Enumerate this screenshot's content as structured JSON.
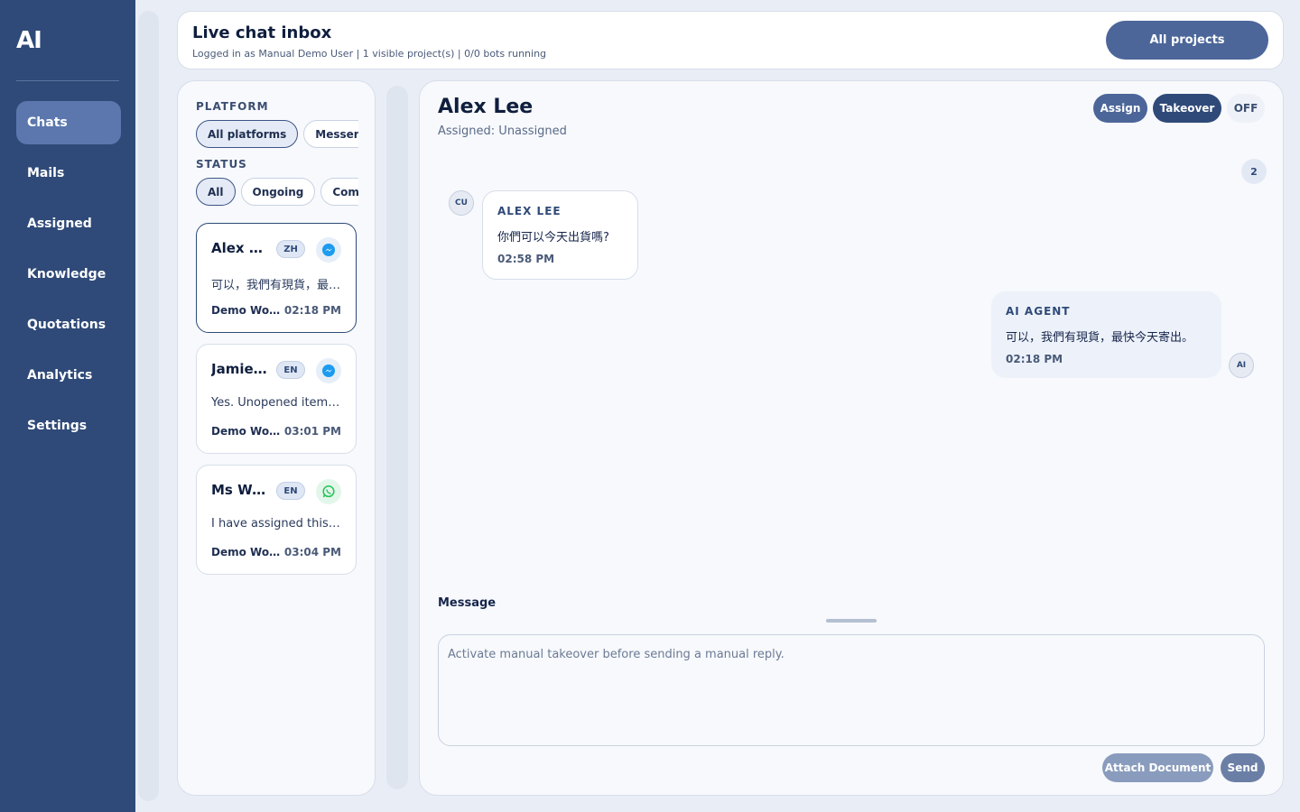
{
  "app": {
    "logo": "AI"
  },
  "sidebar": {
    "items": [
      {
        "label": "Chats",
        "active": true
      },
      {
        "label": "Mails"
      },
      {
        "label": "Assigned"
      },
      {
        "label": "Knowledge"
      },
      {
        "label": "Quotations"
      },
      {
        "label": "Analytics"
      },
      {
        "label": "Settings"
      }
    ]
  },
  "header": {
    "title": "Live chat inbox",
    "subtitle": "Logged in as Manual Demo User | 1 visible project(s) | 0/0 bots running",
    "projects_button": "All projects"
  },
  "filters": {
    "platform_label": "PLATFORM",
    "platform_chips": [
      "All platforms",
      "Messenger"
    ],
    "status_label": "STATUS",
    "status_chips": [
      "All",
      "Ongoing",
      "Completed"
    ]
  },
  "conversations": [
    {
      "name": "Alex Lee",
      "lang": "ZH",
      "platform": "messenger-icon",
      "preview": "可以，我們有現貨，最快今天寄出。",
      "workspace": "Demo Workspace",
      "time": "02:18 PM",
      "selected": true
    },
    {
      "name": "Jamie Chan",
      "lang": "EN",
      "platform": "messenger-icon",
      "preview": "Yes. Unopened items can be returned.",
      "workspace": "Demo Workspace",
      "time": "03:01 PM"
    },
    {
      "name": "Ms Wong",
      "lang": "EN",
      "platform": "whatsapp-icon",
      "preview": "I have assigned this request to our team.",
      "workspace": "Demo Workspace",
      "time": "03:04 PM"
    }
  ],
  "chat": {
    "name": "Alex Lee",
    "assigned": "Assigned: Unassigned",
    "actions": {
      "assign": "Assign",
      "takeover": "Takeover",
      "off": "OFF"
    },
    "message_count": "2",
    "messages": [
      {
        "avatar": "CU",
        "author": "ALEX LEE",
        "text": "你們可以今天出貨嗎?",
        "time": "02:58 PM"
      },
      {
        "avatar": "AI",
        "author": "AI AGENT",
        "text": "可以，我們有現貨，最快今天寄出。",
        "time": "02:18 PM"
      }
    ],
    "composer": {
      "label": "Message",
      "placeholder": "Activate manual takeover before sending a manual reply.",
      "attach": "Attach Document",
      "send": "Send"
    }
  },
  "colors": {
    "sidebar": "#2f4a78",
    "accent": "#4c6699",
    "background": "#e9eef6"
  }
}
